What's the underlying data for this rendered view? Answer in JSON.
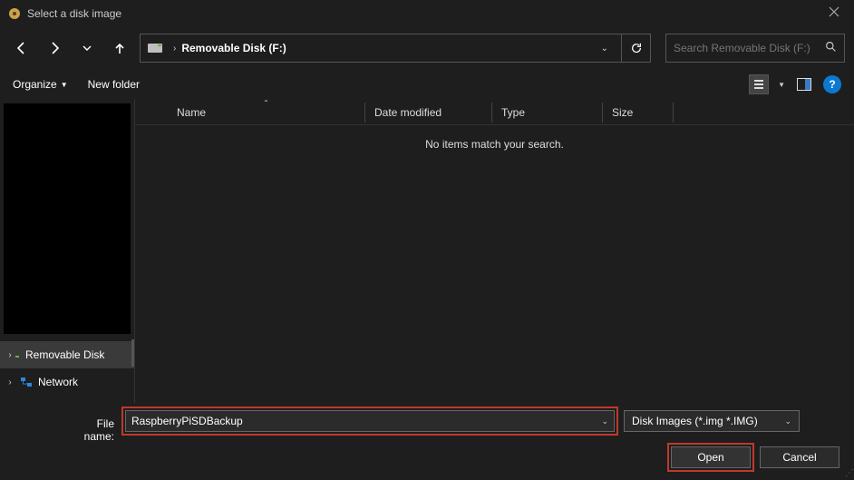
{
  "window": {
    "title": "Select a disk image"
  },
  "breadcrumb": {
    "location": "Removable Disk (F:)"
  },
  "search": {
    "placeholder": "Search Removable Disk (F:)"
  },
  "toolbar": {
    "organize": "Organize",
    "new_folder": "New folder",
    "help": "?"
  },
  "columns": {
    "name": "Name",
    "date": "Date modified",
    "type": "Type",
    "size": "Size"
  },
  "content": {
    "empty_message": "No items match your search."
  },
  "tree": {
    "removable": "Removable Disk",
    "network": "Network"
  },
  "footer": {
    "filename_label": "File name:",
    "filename_value": "RaspberryPiSDBackup",
    "filetype": "Disk Images (*.img *.IMG)",
    "open": "Open",
    "cancel": "Cancel"
  }
}
